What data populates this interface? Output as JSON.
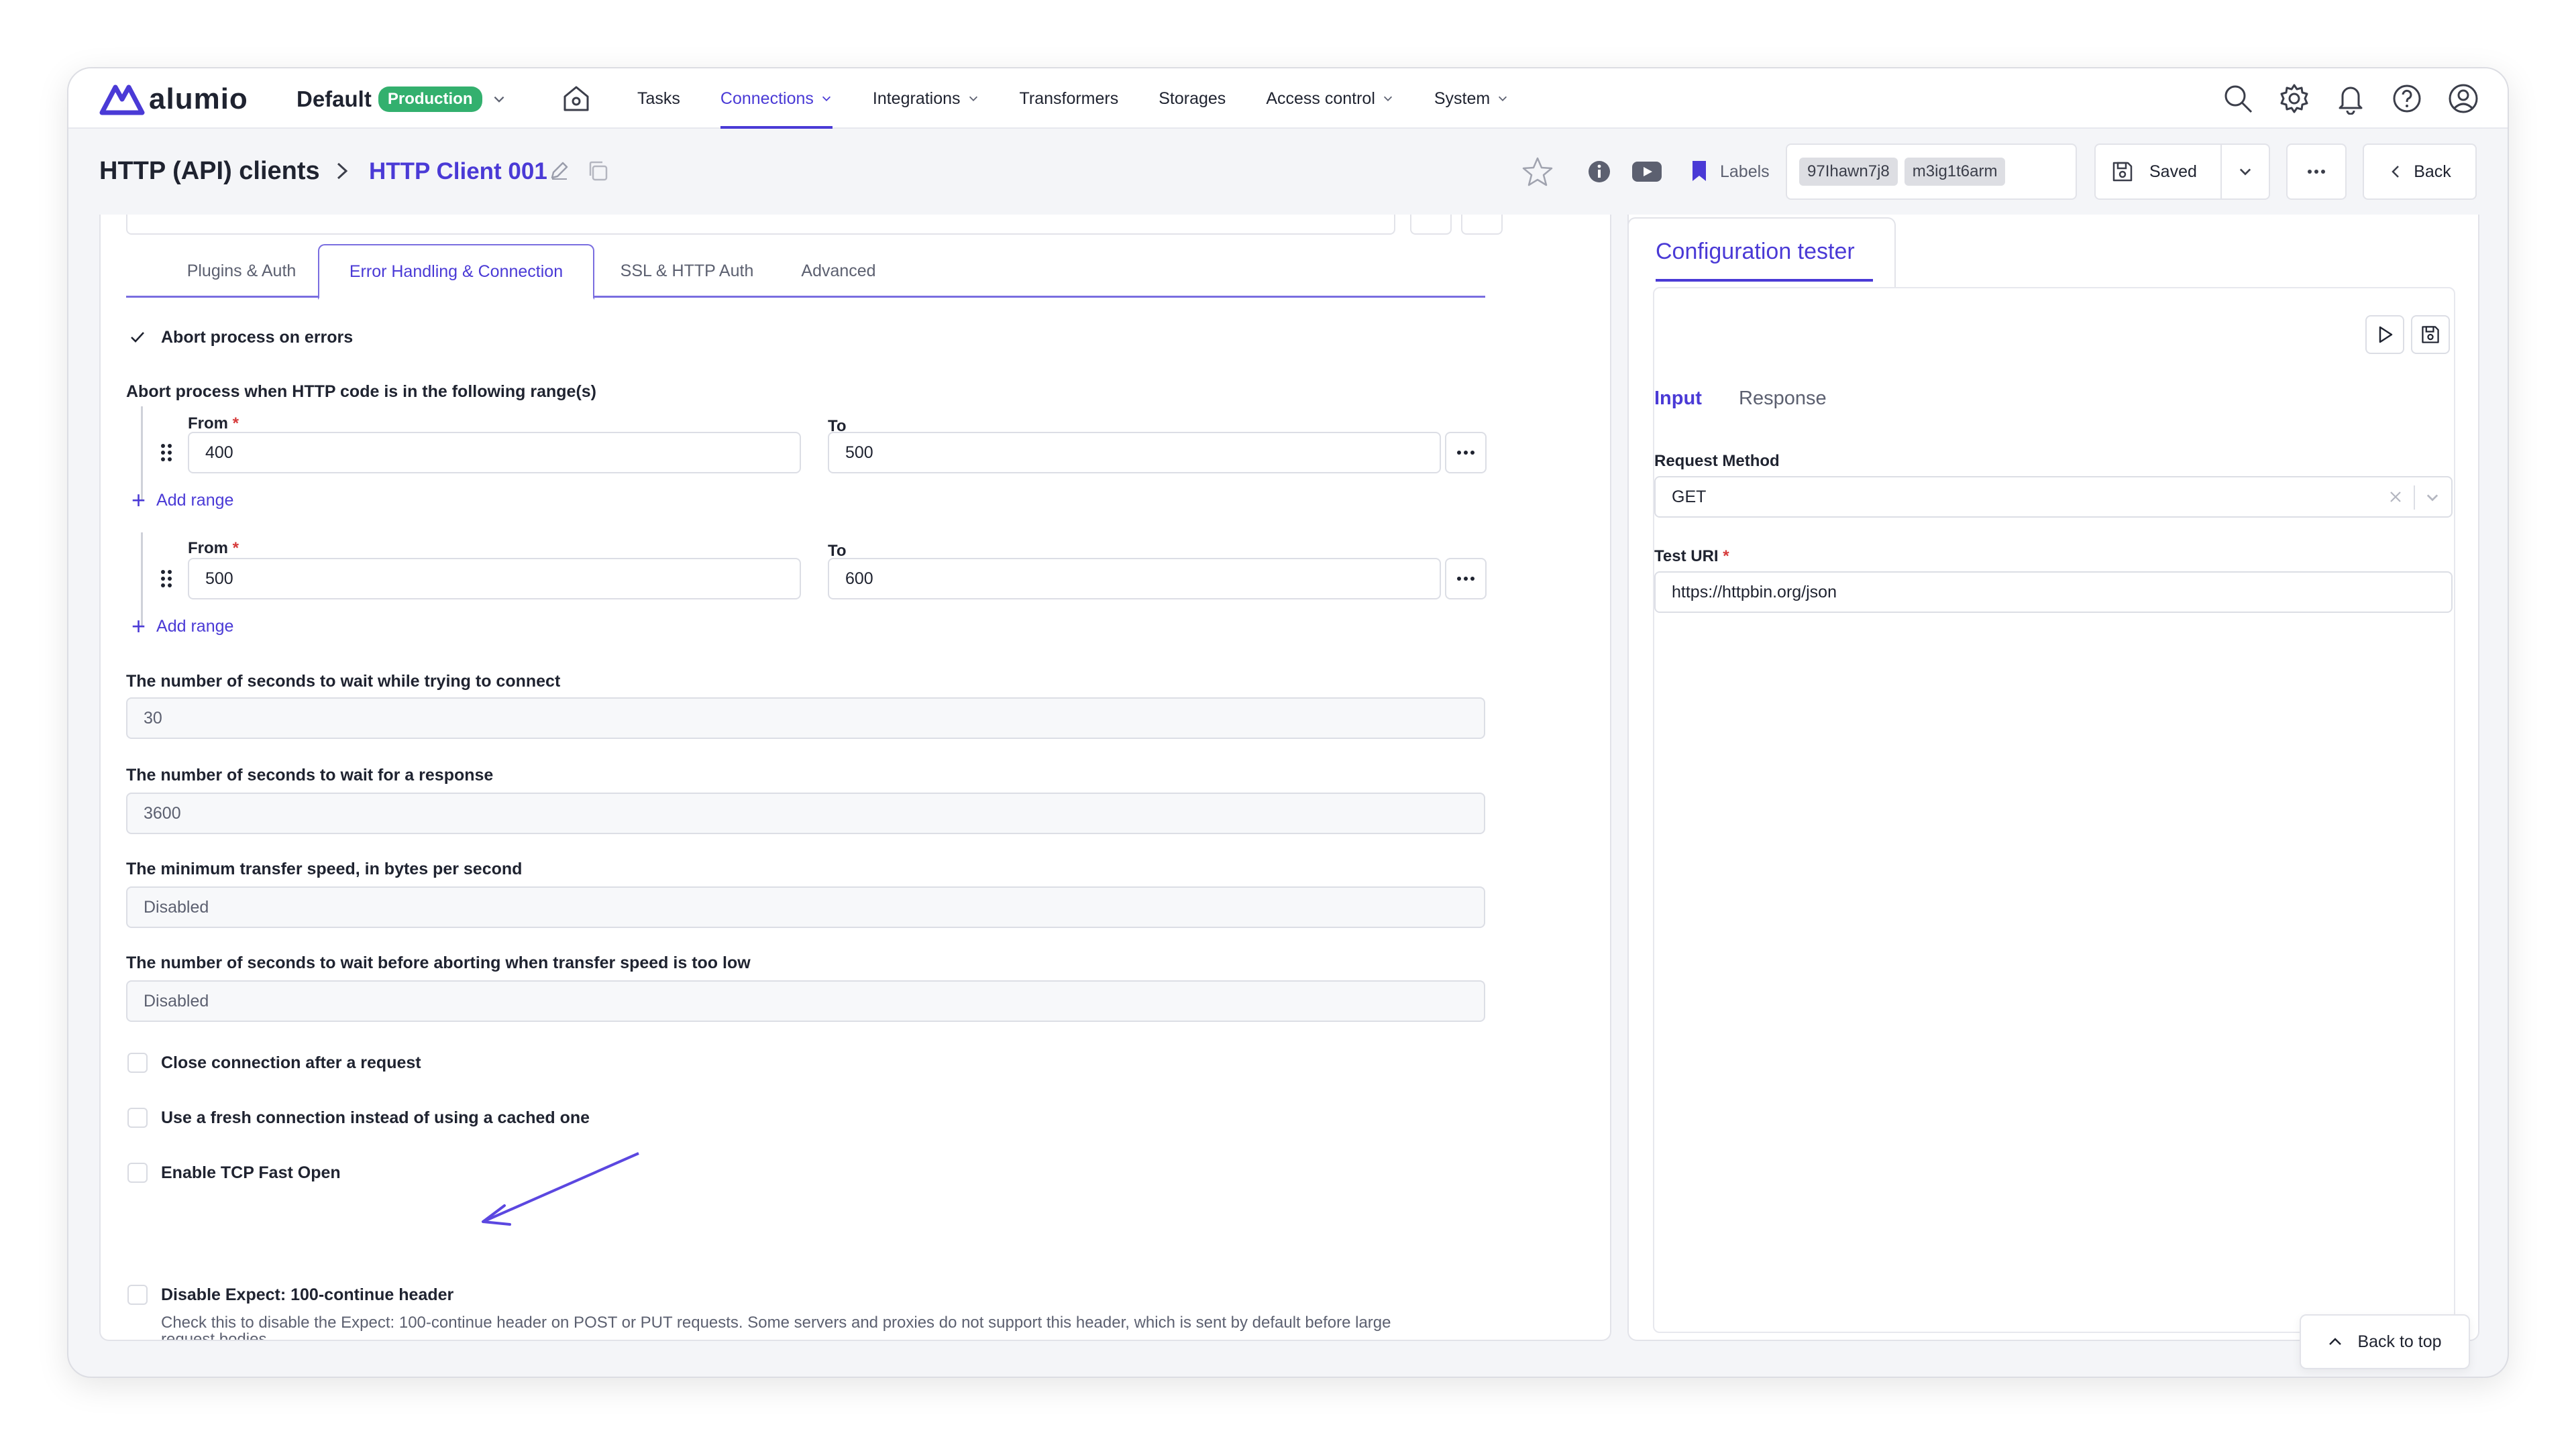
{
  "app": {
    "brand": "alumio",
    "environment": {
      "name": "Default",
      "badge": "Production"
    }
  },
  "nav": {
    "items": [
      {
        "label": "Tasks",
        "has_caret": false,
        "active": false
      },
      {
        "label": "Connections",
        "has_caret": true,
        "active": true
      },
      {
        "label": "Integrations",
        "has_caret": true,
        "active": false
      },
      {
        "label": "Transformers",
        "has_caret": false,
        "active": false
      },
      {
        "label": "Storages",
        "has_caret": false,
        "active": false
      },
      {
        "label": "Access control",
        "has_caret": true,
        "active": false
      },
      {
        "label": "System",
        "has_caret": true,
        "active": false
      }
    ],
    "icons": [
      "search-icon",
      "gear-icon",
      "bell-icon",
      "help-icon",
      "user-icon"
    ]
  },
  "header": {
    "breadcrumb_root": "HTTP (API) clients",
    "breadcrumb_current": "HTTP Client 001",
    "labels_text": "Labels",
    "label_chips": [
      "97Ihawn7j8",
      "m3ig1t6arm"
    ],
    "saved_label": "Saved",
    "back_label": "Back"
  },
  "tabs": [
    {
      "label": "Plugins & Auth",
      "active": false
    },
    {
      "label": "Error Handling & Connection",
      "active": true
    },
    {
      "label": "SSL & HTTP Auth",
      "active": false
    },
    {
      "label": "Advanced",
      "active": false
    }
  ],
  "form": {
    "abort_on_errors": {
      "label": "Abort process on errors",
      "checked": true
    },
    "ranges_label": "Abort process when HTTP code is in the following range(s)",
    "from_label": "From",
    "to_label": "To",
    "required_mark": "*",
    "ranges": [
      {
        "from": "400",
        "to": "500"
      },
      {
        "from": "500",
        "to": "600"
      }
    ],
    "add_range_label": "Add range",
    "connect_timeout": {
      "label": "The number of seconds to wait while trying to connect",
      "value": "30"
    },
    "response_timeout": {
      "label": "The number of seconds to wait for a response",
      "value": "3600"
    },
    "min_speed": {
      "label": "The minimum transfer speed, in bytes per second",
      "value": "Disabled"
    },
    "low_speed_timeout": {
      "label": "The number of seconds to wait before aborting when transfer speed is too low",
      "value": "Disabled"
    },
    "checkboxes": [
      {
        "label": "Close connection after a request",
        "checked": false
      },
      {
        "label": "Use a fresh connection instead of using a cached one",
        "checked": false
      },
      {
        "label": "Enable TCP Fast Open",
        "checked": false
      },
      {
        "label": "Disable Expect: 100-continue header",
        "checked": false
      }
    ],
    "expect_help": "Check this to disable the Expect: 100-continue header on POST or PUT requests. Some servers and proxies do not support this header, which is sent by default before large request bodies."
  },
  "tester": {
    "title": "Configuration tester",
    "tabs": [
      {
        "label": "Input",
        "active": true
      },
      {
        "label": "Response",
        "active": false
      }
    ],
    "request_method_label": "Request Method",
    "request_method_value": "GET",
    "test_uri_label": "Test URI",
    "test_uri_value": "https://httpbin.org/json",
    "back_to_top": "Back to top"
  },
  "colors": {
    "accent": "#4a3ad6",
    "success": "#33b06e",
    "required": "#d63b3b"
  }
}
